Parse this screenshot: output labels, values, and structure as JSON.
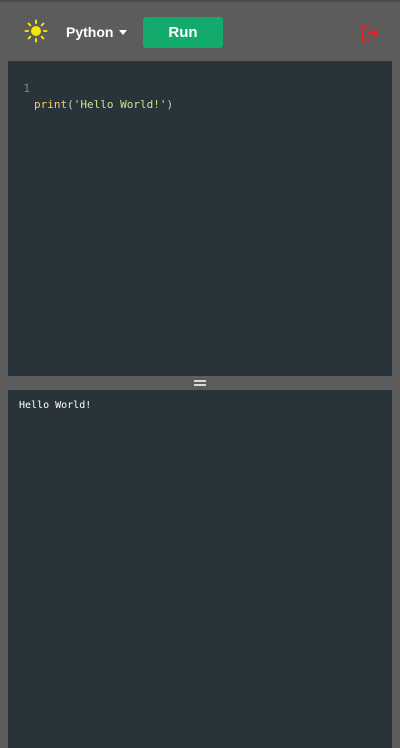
{
  "toolbar": {
    "theme_icon": "sun-icon",
    "language": "Python",
    "run_label": "Run",
    "logout_icon": "logout-icon",
    "colors": {
      "background": "#5c5c5c",
      "run_button": "#13ab6c",
      "theme_icon": "#f5e50a",
      "logout_icon": "#e8201f"
    }
  },
  "editor": {
    "lines": [
      {
        "number": "1",
        "tokens": {
          "fn": "print",
          "open": "(",
          "string": "'Hello World!'",
          "close": ")"
        }
      }
    ],
    "colors": {
      "background": "#29343a",
      "function": "#ffcb6b",
      "string": "#c3e88d"
    }
  },
  "divider": {
    "icon": "drag-handle-icon"
  },
  "output": {
    "text": "Hello World!"
  }
}
